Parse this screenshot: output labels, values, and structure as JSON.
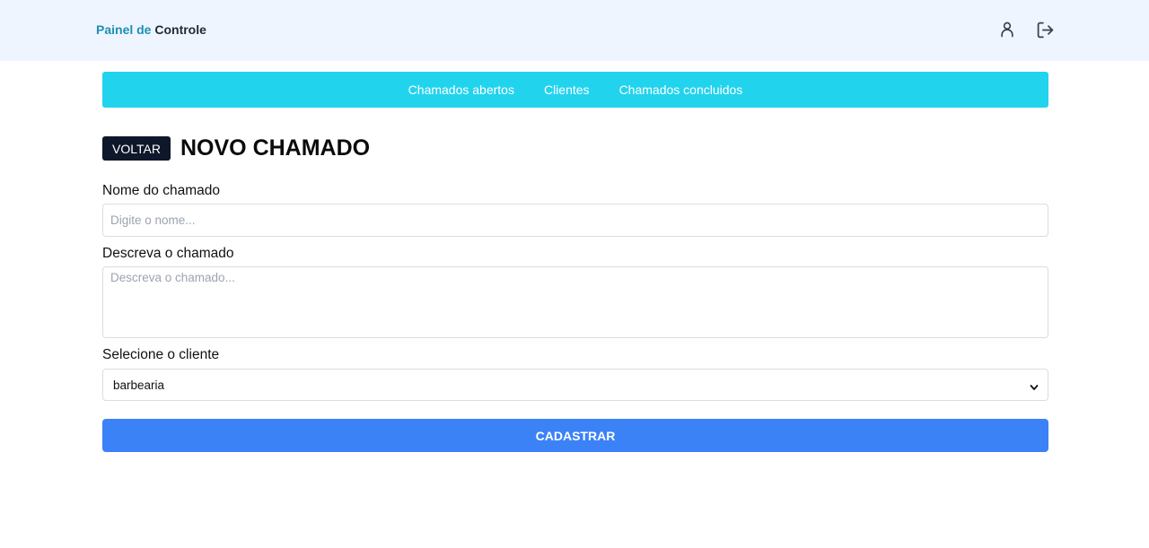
{
  "header": {
    "brand_part1": "Painel de",
    "brand_part2": "Controle",
    "icons": [
      "user-icon",
      "logout-icon"
    ]
  },
  "nav": {
    "items": [
      {
        "label": "Chamados abertos"
      },
      {
        "label": "Clientes"
      },
      {
        "label": "Chamados concluidos"
      }
    ]
  },
  "page": {
    "back_label": "VOLTAR",
    "title": "NOVO CHAMADO"
  },
  "form": {
    "name_label": "Nome do chamado",
    "name_placeholder": "Digite o nome...",
    "name_value": "",
    "desc_label": "Descreva o chamado",
    "desc_placeholder": "Descreva o chamado...",
    "desc_value": "",
    "client_label": "Selecione o cliente",
    "client_selected": "barbearia",
    "submit_label": "CADASTRAR"
  },
  "colors": {
    "header_bg": "#eef5ff",
    "nav_bg": "#22d3ee",
    "back_button_bg": "#0f172a",
    "submit_bg": "#3b82f6",
    "brand_accent": "#1e8fb3"
  }
}
